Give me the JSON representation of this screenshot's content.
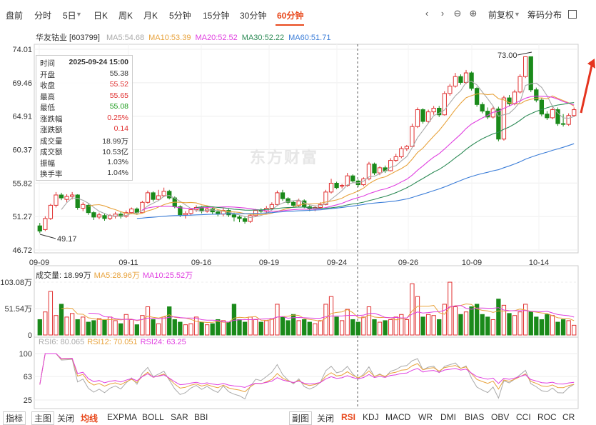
{
  "tabs": [
    "盘前",
    "分时",
    "5日",
    "日K",
    "周K",
    "月K",
    "5分钟",
    "15分钟",
    "30分钟",
    "60分钟"
  ],
  "active_tab": "60分钟",
  "controls": {
    "fuquan": "前复权",
    "chouma": "筹码分布"
  },
  "stock": {
    "name": "华友钴业 [603799]"
  },
  "ma_legend": [
    {
      "label": "MA5:54.68",
      "color": "#aaaaaa"
    },
    {
      "label": "MA10:53.39",
      "color": "#e8a33d"
    },
    {
      "label": "MA20:52.52",
      "color": "#e040e0"
    },
    {
      "label": "MA30:52.22",
      "color": "#2e8b57"
    },
    {
      "label": "MA60:51.71",
      "color": "#3b7dd8"
    }
  ],
  "tooltip": [
    {
      "k": "时间",
      "v": "2025-09-24 15:00",
      "c": "#333333",
      "bold": true
    },
    {
      "k": "开盘",
      "v": "55.38",
      "c": "#333333"
    },
    {
      "k": "收盘",
      "v": "55.52",
      "c": "#e03030"
    },
    {
      "k": "最高",
      "v": "55.65",
      "c": "#e03030"
    },
    {
      "k": "最低",
      "v": "55.08",
      "c": "#1a9a1a"
    },
    {
      "k": "涨跌幅",
      "v": "0.25%",
      "c": "#e03030"
    },
    {
      "k": "涨跌额",
      "v": "0.14",
      "c": "#e03030"
    },
    {
      "k": "成交量",
      "v": "18.99万",
      "c": "#333333"
    },
    {
      "k": "成交额",
      "v": "10.53亿",
      "c": "#333333"
    },
    {
      "k": "振幅",
      "v": "1.03%",
      "c": "#333333"
    },
    {
      "k": "换手率",
      "v": "1.04%",
      "c": "#333333"
    }
  ],
  "watermark": "东方财富",
  "volume_legend": [
    {
      "label": "成交量: 18.99万",
      "color": "#333333"
    },
    {
      "label": "MA5:28.96万",
      "color": "#e8a33d"
    },
    {
      "label": "MA10:25.52万",
      "color": "#e040e0"
    }
  ],
  "rsi_legend": [
    {
      "label": "RSI6: 80.065",
      "color": "#aaaaaa"
    },
    {
      "label": "RSI12: 70.051",
      "color": "#e8a33d"
    },
    {
      "label": "RSI24: 63.25",
      "color": "#e040e0"
    }
  ],
  "bottom_bar": {
    "left": [
      "指标",
      "主图",
      "关闭",
      "均线",
      "EXPMA",
      "BOLL",
      "SAR",
      "BBI"
    ],
    "left_active": "均线",
    "right": [
      "副图",
      "关闭",
      "RSI",
      "KDJ",
      "MACD",
      "WR",
      "DMI",
      "BIAS",
      "OBV",
      "CCI",
      "ROC",
      "CR"
    ],
    "right_active": "RSI"
  },
  "chart_data": {
    "type": "candlestick",
    "interval": "60分钟",
    "price_axis": {
      "ticks": [
        "74.01",
        "69.46",
        "64.91",
        "60.37",
        "55.82",
        "51.27",
        "46.72"
      ],
      "range": [
        46.72,
        74.01
      ]
    },
    "date_ticks": [
      "09-09",
      "09-11",
      "09-16",
      "09-19",
      "09-24",
      "09-26",
      "10-09",
      "10-14"
    ],
    "annotations": [
      {
        "text": "73.00"
      },
      {
        "text": "49.17"
      }
    ],
    "candles": [
      [
        50.0,
        49.3,
        50.4,
        49.0
      ],
      [
        49.5,
        51.0,
        51.3,
        49.3
      ],
      [
        51.0,
        52.8,
        53.0,
        50.8
      ],
      [
        52.8,
        54.2,
        54.6,
        52.5
      ],
      [
        54.2,
        53.8,
        54.5,
        53.5
      ],
      [
        53.6,
        54.0,
        54.3,
        53.2
      ],
      [
        54.0,
        54.2,
        54.6,
        53.6
      ],
      [
        54.2,
        52.5,
        54.3,
        52.2
      ],
      [
        52.4,
        52.9,
        53.2,
        52.0
      ],
      [
        52.8,
        51.8,
        53.0,
        51.5
      ],
      [
        51.8,
        51.2,
        52.0,
        50.8
      ],
      [
        51.2,
        51.5,
        51.8,
        50.9
      ],
      [
        51.4,
        51.0,
        51.7,
        50.7
      ],
      [
        51.0,
        51.4,
        51.6,
        50.8
      ],
      [
        51.3,
        51.6,
        51.9,
        51.0
      ],
      [
        51.6,
        51.3,
        51.9,
        51.0
      ],
      [
        51.3,
        51.8,
        52.1,
        51.1
      ],
      [
        51.8,
        52.3,
        52.5,
        51.6
      ],
      [
        52.3,
        51.8,
        52.5,
        51.5
      ],
      [
        51.8,
        53.2,
        53.4,
        51.7
      ],
      [
        53.2,
        54.5,
        54.8,
        53.0
      ],
      [
        54.5,
        53.6,
        54.7,
        53.3
      ],
      [
        53.6,
        54.1,
        54.9,
        53.4
      ],
      [
        54.1,
        54.7,
        55.2,
        53.9
      ],
      [
        54.7,
        53.8,
        54.9,
        53.6
      ],
      [
        53.8,
        52.6,
        54.0,
        52.4
      ],
      [
        52.6,
        51.5,
        52.8,
        51.2
      ],
      [
        51.5,
        51.7,
        52.0,
        51.0
      ],
      [
        51.7,
        52.2,
        52.4,
        51.4
      ],
      [
        52.2,
        52.5,
        52.8,
        51.9
      ],
      [
        52.5,
        52.0,
        52.7,
        51.7
      ],
      [
        52.0,
        52.3,
        52.6,
        51.8
      ],
      [
        52.3,
        51.9,
        52.5,
        51.6
      ],
      [
        51.9,
        51.6,
        52.2,
        51.3
      ],
      [
        51.6,
        52.1,
        52.4,
        51.3
      ],
      [
        52.1,
        51.5,
        52.3,
        51.2
      ],
      [
        51.5,
        51.2,
        51.8,
        50.6
      ],
      [
        51.2,
        51.0,
        51.4,
        50.5
      ],
      [
        51.0,
        50.6,
        51.3,
        50.3
      ],
      [
        50.6,
        51.4,
        51.6,
        50.4
      ],
      [
        51.4,
        52.1,
        52.3,
        51.2
      ],
      [
        52.1,
        52.0,
        52.4,
        51.7
      ],
      [
        52.0,
        52.4,
        52.7,
        51.8
      ],
      [
        52.4,
        52.9,
        53.2,
        52.2
      ],
      [
        52.9,
        54.5,
        54.8,
        52.7
      ],
      [
        54.5,
        53.7,
        54.9,
        53.4
      ],
      [
        53.7,
        53.2,
        53.9,
        52.9
      ],
      [
        53.2,
        52.8,
        53.4,
        52.5
      ],
      [
        52.8,
        53.4,
        53.7,
        52.6
      ],
      [
        53.4,
        52.6,
        53.6,
        52.4
      ],
      [
        52.6,
        52.3,
        52.8,
        52.0
      ],
      [
        52.3,
        52.5,
        52.7,
        52.0
      ],
      [
        52.5,
        52.9,
        53.2,
        52.3
      ],
      [
        52.9,
        54.6,
        54.9,
        52.8
      ],
      [
        54.6,
        55.8,
        56.4,
        54.4
      ],
      [
        55.8,
        55.2,
        56.0,
        55.0
      ],
      [
        55.4,
        55.5,
        55.7,
        55.1
      ],
      [
        55.5,
        56.8,
        57.2,
        55.3
      ],
      [
        56.8,
        56.1,
        57.0,
        55.8
      ],
      [
        56.1,
        55.6,
        56.3,
        55.3
      ],
      [
        55.6,
        56.4,
        56.6,
        55.4
      ],
      [
        56.4,
        58.4,
        58.7,
        56.2
      ],
      [
        58.4,
        57.2,
        58.6,
        56.9
      ],
      [
        57.2,
        57.9,
        58.1,
        56.9
      ],
      [
        57.9,
        57.5,
        58.2,
        57.2
      ],
      [
        57.5,
        58.9,
        59.2,
        57.4
      ],
      [
        58.9,
        59.4,
        59.8,
        58.7
      ],
      [
        59.4,
        60.5,
        60.8,
        59.2
      ],
      [
        60.5,
        60.8,
        61.0,
        60.2
      ],
      [
        60.8,
        63.5,
        63.9,
        60.6
      ],
      [
        63.5,
        65.8,
        66.1,
        63.3
      ],
      [
        65.8,
        64.2,
        66.0,
        63.9
      ],
      [
        64.2,
        65.5,
        65.8,
        64.0
      ],
      [
        65.5,
        66.0,
        66.3,
        65.1
      ],
      [
        66.0,
        65.1,
        66.3,
        64.8
      ],
      [
        65.1,
        68.0,
        68.3,
        65.0
      ],
      [
        68.0,
        69.0,
        69.3,
        67.7
      ],
      [
        69.0,
        70.3,
        70.8,
        68.8
      ],
      [
        70.3,
        69.5,
        70.6,
        69.2
      ],
      [
        69.5,
        70.8,
        71.2,
        69.3
      ],
      [
        70.8,
        68.7,
        71.0,
        68.4
      ],
      [
        68.7,
        66.5,
        68.9,
        66.2
      ],
      [
        66.5,
        65.6,
        66.8,
        65.3
      ],
      [
        65.6,
        64.8,
        66.1,
        64.5
      ],
      [
        64.8,
        65.9,
        66.2,
        64.6
      ],
      [
        65.9,
        61.8,
        66.2,
        61.5
      ],
      [
        61.8,
        67.4,
        67.7,
        61.6
      ],
      [
        67.4,
        66.6,
        67.8,
        66.3
      ],
      [
        66.6,
        68.2,
        68.5,
        66.4
      ],
      [
        68.2,
        70.3,
        70.6,
        68.0
      ],
      [
        70.3,
        73.0,
        73.0,
        70.1
      ],
      [
        73.0,
        68.5,
        73.0,
        68.2
      ],
      [
        68.5,
        67.1,
        68.8,
        66.8
      ],
      [
        67.1,
        65.2,
        67.4,
        64.9
      ],
      [
        65.2,
        64.7,
        65.6,
        64.4
      ],
      [
        64.7,
        65.8,
        66.1,
        64.5
      ],
      [
        65.8,
        63.9,
        66.1,
        63.6
      ],
      [
        63.9,
        63.8,
        65.2,
        63.5
      ],
      [
        63.8,
        65.0,
        65.3,
        63.6
      ],
      [
        65.0,
        65.8,
        66.1,
        64.8
      ]
    ],
    "volume_axis": {
      "ticks": [
        "103.08万",
        "51.54万",
        "0"
      ],
      "range": [
        0,
        103.08
      ]
    },
    "volume": [
      30,
      45,
      85,
      38,
      60,
      35,
      42,
      30,
      35,
      25,
      28,
      32,
      30,
      35,
      28,
      22,
      40,
      30,
      20,
      38,
      55,
      30,
      22,
      35,
      55,
      30,
      25,
      20,
      22,
      35,
      25,
      20,
      22,
      30,
      28,
      25,
      60,
      30,
      25,
      35,
      30,
      25,
      28,
      32,
      60,
      35,
      28,
      40,
      28,
      30,
      25,
      22,
      28,
      60,
      75,
      35,
      28,
      50,
      30,
      25,
      35,
      55,
      30,
      25,
      28,
      30,
      35,
      40,
      30,
      100,
      75,
      35,
      40,
      38,
      30,
      60,
      103,
      55,
      40,
      45,
      55,
      60,
      40,
      35,
      30,
      70,
      58,
      42,
      38,
      45,
      60,
      45,
      35,
      30,
      40,
      38,
      25,
      30,
      28,
      19
    ],
    "rsi_axis": {
      "ticks": [
        "100",
        "63",
        "25"
      ],
      "range": [
        25,
        100
      ]
    }
  }
}
